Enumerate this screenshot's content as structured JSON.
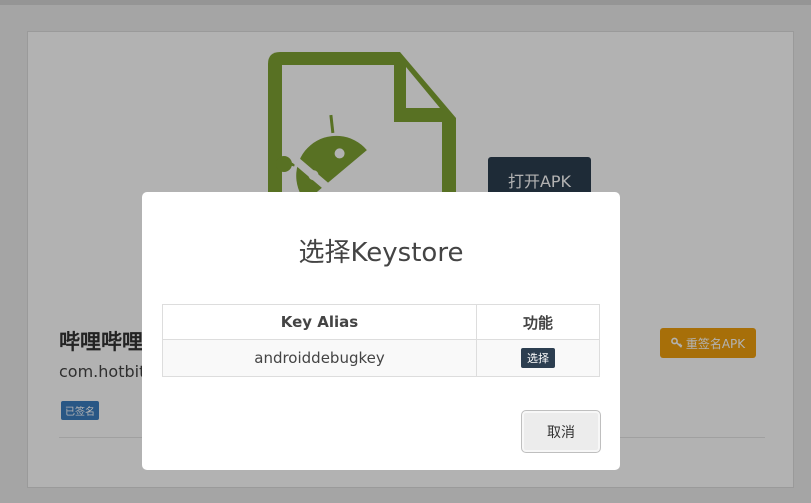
{
  "background": {
    "open_apk_label": "打开APK",
    "app_name": "哔哩哔哩",
    "package_name": "com.hotbitmapgg.bilibili",
    "signed_badge": "已签名",
    "resign_label": "重签名APK",
    "colors": {
      "apk_icon": "#7ea233",
      "open_button": "#2c3e50",
      "resign_button": "#f0a00d",
      "badge": "#3b7dbf"
    }
  },
  "modal": {
    "title": "选择Keystore",
    "table": {
      "headers": [
        "Key Alias",
        "功能"
      ],
      "rows": [
        {
          "alias": "androiddebugkey",
          "action_label": "选择"
        }
      ]
    },
    "cancel_label": "取消"
  }
}
